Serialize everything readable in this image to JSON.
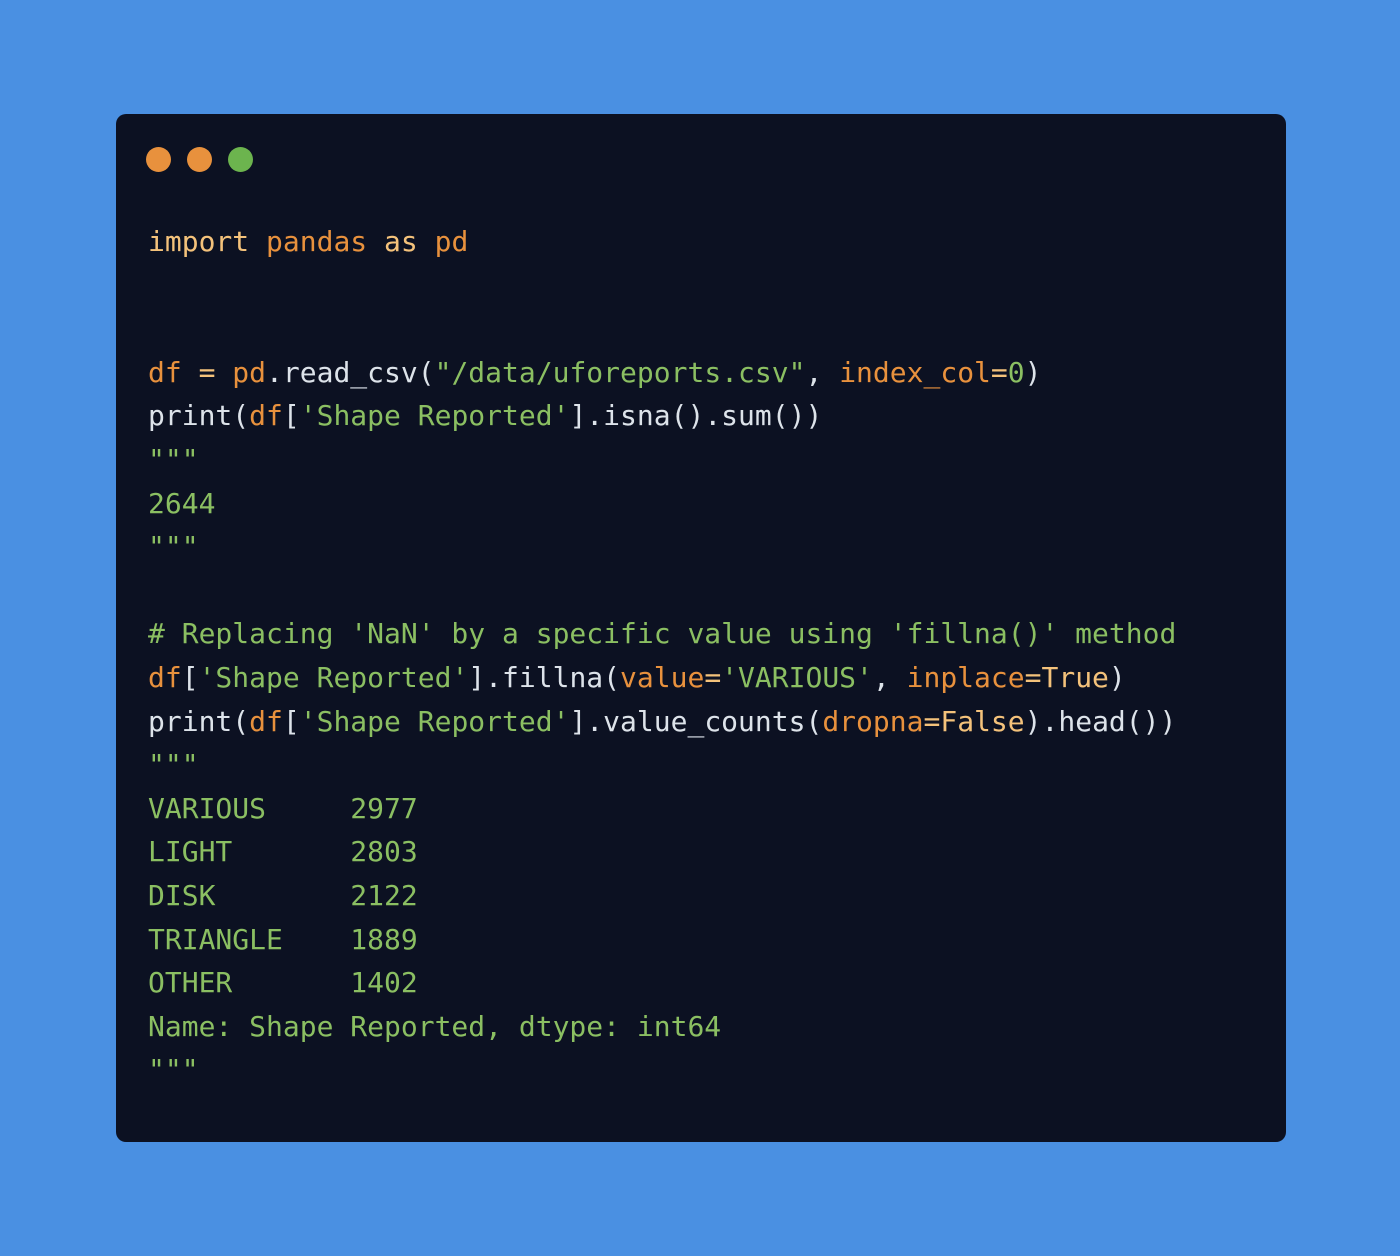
{
  "window": {
    "controls": [
      {
        "name": "close",
        "color": "#e8913d"
      },
      {
        "name": "minimize",
        "color": "#e8913d"
      },
      {
        "name": "maximize",
        "color": "#6cb44e"
      }
    ]
  },
  "code": {
    "lines": [
      [
        {
          "t": "import",
          "c": "kw"
        },
        {
          "t": " ",
          "c": "pl"
        },
        {
          "t": "pandas",
          "c": "mod"
        },
        {
          "t": " ",
          "c": "pl"
        },
        {
          "t": "as",
          "c": "kw"
        },
        {
          "t": " ",
          "c": "pl"
        },
        {
          "t": "pd",
          "c": "mod"
        }
      ],
      [],
      [],
      [
        {
          "t": "df",
          "c": "mod"
        },
        {
          "t": " ",
          "c": "pl"
        },
        {
          "t": "=",
          "c": "op"
        },
        {
          "t": " ",
          "c": "pl"
        },
        {
          "t": "pd",
          "c": "mod"
        },
        {
          "t": ".read_csv(",
          "c": "fn"
        },
        {
          "t": "\"/data/uforeports.csv\"",
          "c": "str"
        },
        {
          "t": ", ",
          "c": "pl"
        },
        {
          "t": "index_col",
          "c": "arg"
        },
        {
          "t": "=",
          "c": "op"
        },
        {
          "t": "0",
          "c": "num"
        },
        {
          "t": ")",
          "c": "pl"
        }
      ],
      [
        {
          "t": "print(",
          "c": "fn"
        },
        {
          "t": "df",
          "c": "mod"
        },
        {
          "t": "[",
          "c": "pl"
        },
        {
          "t": "'Shape Reported'",
          "c": "str"
        },
        {
          "t": "].isna().sum())",
          "c": "fn"
        }
      ],
      [
        {
          "t": "\"\"\"",
          "c": "out"
        }
      ],
      [
        {
          "t": "2644",
          "c": "out"
        }
      ],
      [
        {
          "t": "\"\"\"",
          "c": "out"
        }
      ],
      [],
      [
        {
          "t": "# Replacing 'NaN' by a specific value using 'fillna()' method",
          "c": "cmt"
        }
      ],
      [
        {
          "t": "df",
          "c": "mod"
        },
        {
          "t": "[",
          "c": "pl"
        },
        {
          "t": "'Shape Reported'",
          "c": "str"
        },
        {
          "t": "].fillna(",
          "c": "fn"
        },
        {
          "t": "value",
          "c": "arg"
        },
        {
          "t": "=",
          "c": "op"
        },
        {
          "t": "'VARIOUS'",
          "c": "str"
        },
        {
          "t": ", ",
          "c": "pl"
        },
        {
          "t": "inplace",
          "c": "arg"
        },
        {
          "t": "=",
          "c": "op"
        },
        {
          "t": "True",
          "c": "kwv"
        },
        {
          "t": ")",
          "c": "pl"
        }
      ],
      [
        {
          "t": "print(",
          "c": "fn"
        },
        {
          "t": "df",
          "c": "mod"
        },
        {
          "t": "[",
          "c": "pl"
        },
        {
          "t": "'Shape Reported'",
          "c": "str"
        },
        {
          "t": "].value_counts(",
          "c": "fn"
        },
        {
          "t": "dropna",
          "c": "arg"
        },
        {
          "t": "=",
          "c": "op"
        },
        {
          "t": "False",
          "c": "kwv"
        },
        {
          "t": ").head())",
          "c": "fn"
        }
      ],
      [
        {
          "t": "\"\"\"",
          "c": "out"
        }
      ],
      [
        {
          "t": "VARIOUS     2977",
          "c": "out"
        }
      ],
      [
        {
          "t": "LIGHT       2803",
          "c": "out"
        }
      ],
      [
        {
          "t": "DISK        2122",
          "c": "out"
        }
      ],
      [
        {
          "t": "TRIANGLE    1889",
          "c": "out"
        }
      ],
      [
        {
          "t": "OTHER       1402",
          "c": "out"
        }
      ],
      [
        {
          "t": "Name: Shape Reported, dtype: int64",
          "c": "out"
        }
      ],
      [
        {
          "t": "\"\"\"",
          "c": "out"
        }
      ]
    ]
  }
}
